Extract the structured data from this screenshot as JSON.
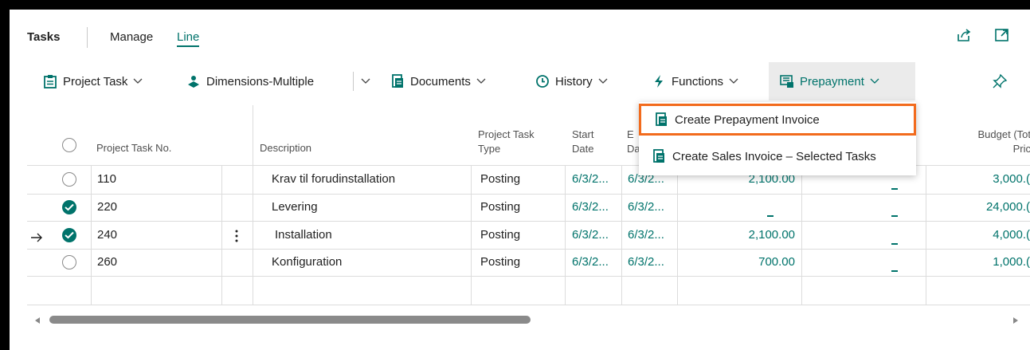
{
  "tabs": {
    "tasks": "Tasks",
    "manage": "Manage",
    "line": "Line"
  },
  "actions": {
    "project_task": "Project Task",
    "dimensions": "Dimensions-Multiple",
    "documents": "Documents",
    "history": "History",
    "functions": "Functions",
    "prepayment": "Prepayment"
  },
  "prepayment_menu": {
    "item1": "Create Prepayment Invoice",
    "item2": "Create Sales Invoice – Selected Tasks"
  },
  "columns": {
    "task_no": "Project Task No.",
    "description": "Description",
    "type_line1": "Project Task",
    "type_line2": "Type",
    "start_line1": "Start",
    "start_line2": "Date",
    "end_line1": "E",
    "end_line2": "Da",
    "budget_line1": "Budget (Tot",
    "budget_line2": "Pric"
  },
  "rows": [
    {
      "no": "110",
      "description": "Krav til forudinstallation",
      "type": "Posting",
      "start": "6/3/2...",
      "end": "6/3/2...",
      "amount": "2,100.00",
      "budget": "3,000.(",
      "selected": false
    },
    {
      "no": "220",
      "description": "Levering",
      "type": "Posting",
      "start": "6/3/2...",
      "end": "6/3/2...",
      "amount": "",
      "budget": "24,000.(",
      "selected": true
    },
    {
      "no": "240",
      "description": "Installation",
      "type": "Posting",
      "start": "6/3/2...",
      "end": "6/3/2...",
      "amount": "2,100.00",
      "budget": "4,000.(",
      "selected": true
    },
    {
      "no": "260",
      "description": "Konfiguration",
      "type": "Posting",
      "start": "6/3/2...",
      "end": "6/3/2...",
      "amount": "700.00",
      "budget": "1,000.(",
      "selected": false
    }
  ],
  "colors": {
    "accent": "#00736b",
    "highlight_border": "#f26b1d"
  }
}
